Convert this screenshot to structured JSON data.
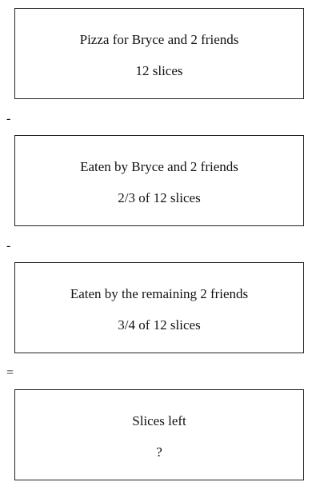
{
  "boxes": [
    {
      "line1": "Pizza for Bryce and 2 friends",
      "line2": "12 slices"
    },
    {
      "line1": "Eaten by Bryce and 2 friends",
      "line2": "2/3 of 12 slices"
    },
    {
      "line1": "Eaten by the remaining 2 friends",
      "line2": "3/4 of 12 slices"
    },
    {
      "line1": "Slices left",
      "line2": "?"
    }
  ],
  "operators": [
    "-",
    "-",
    "="
  ]
}
